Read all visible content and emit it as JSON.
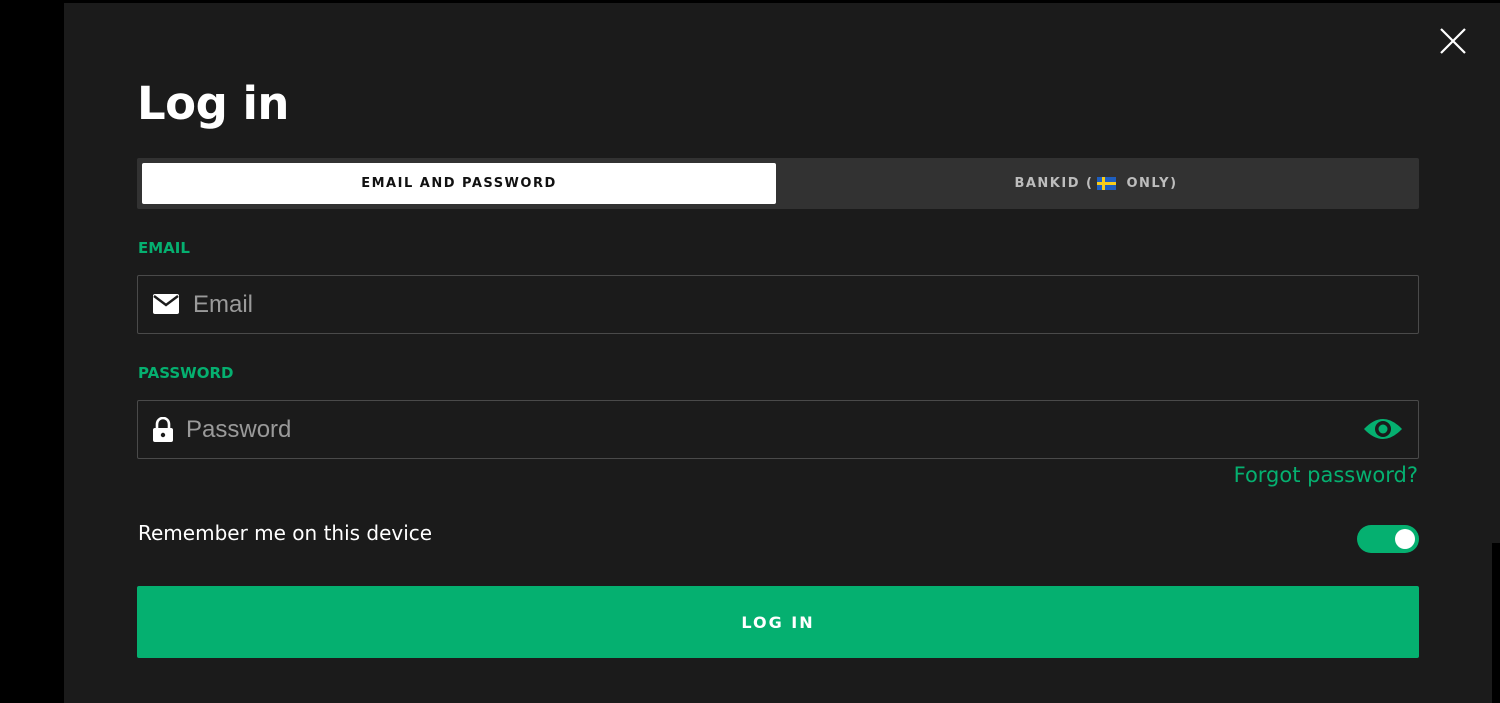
{
  "modal": {
    "title": "Log in",
    "close_icon": "close-icon"
  },
  "tabs": [
    {
      "label": "EMAIL AND PASSWORD",
      "active": true
    },
    {
      "label_before": "BANKID (",
      "flag_icon": "swedish-flag-icon",
      "label_after": " ONLY)",
      "active": false
    }
  ],
  "email": {
    "label": "EMAIL",
    "placeholder": "Email",
    "value": "",
    "icon": "mail-icon"
  },
  "password": {
    "label": "PASSWORD",
    "placeholder": "Password",
    "value": "",
    "icon": "lock-icon",
    "toggle_icon": "eye-icon"
  },
  "forgot_password": "Forgot password?",
  "remember": {
    "label": "Remember me on this device",
    "enabled": true
  },
  "login_button": "LOG IN",
  "colors": {
    "accent": "#05b070",
    "background": "#1b1b1b",
    "tab_bar": "#323232",
    "text": "#ffffff"
  }
}
